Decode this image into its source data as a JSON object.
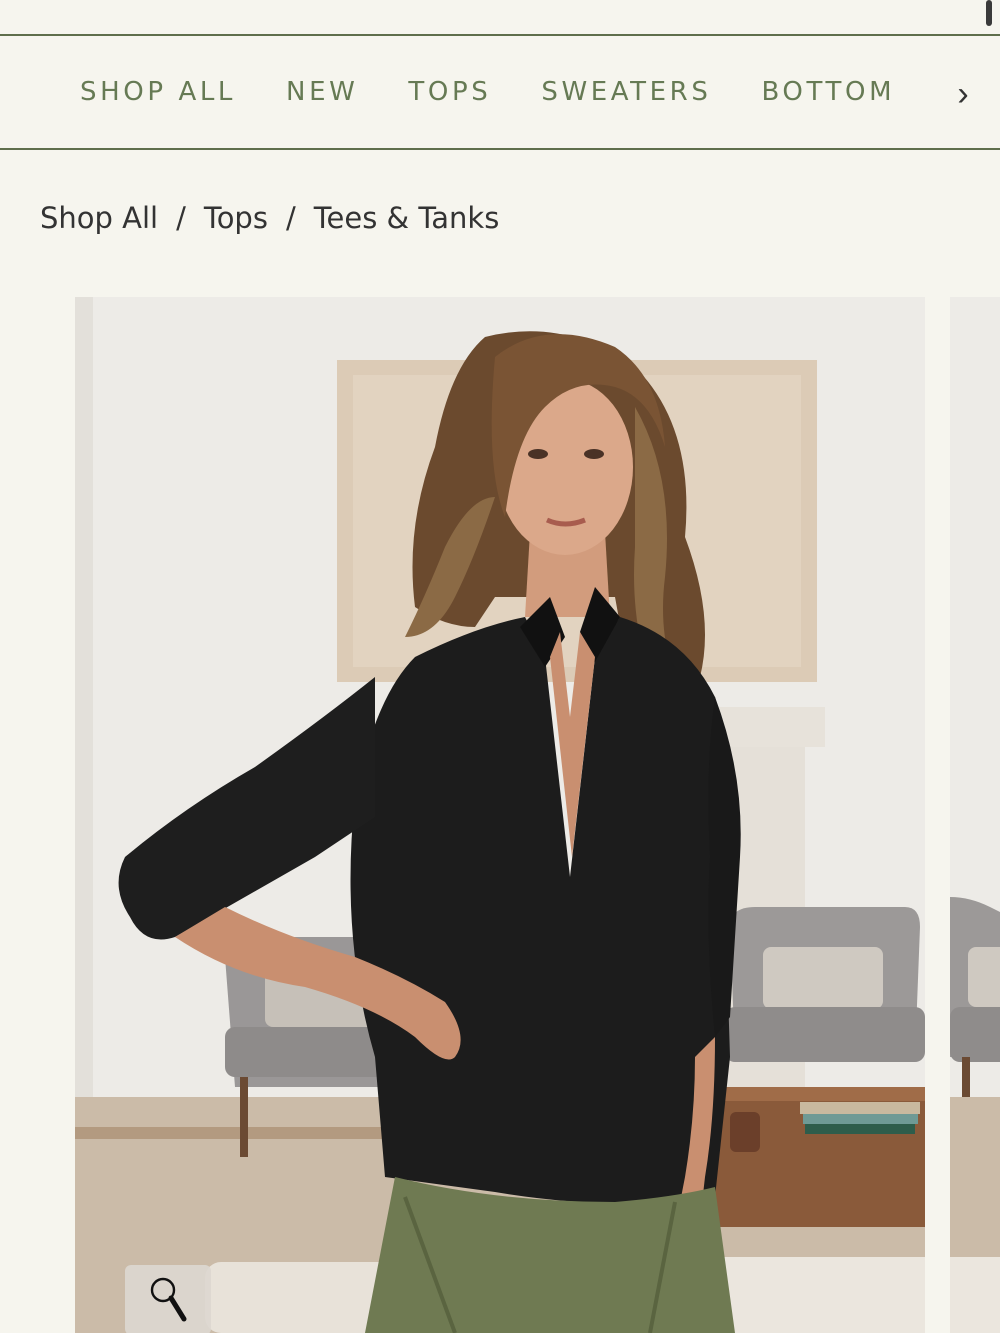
{
  "nav": {
    "items": [
      {
        "label": "SHOP ALL"
      },
      {
        "label": "NEW"
      },
      {
        "label": "TOPS"
      },
      {
        "label": "SWEATERS"
      },
      {
        "label": "BOTTOM"
      }
    ],
    "next_icon": "chevron-right-icon"
  },
  "breadcrumb": {
    "items": [
      "Shop All",
      "Tops",
      "Tees & Tanks"
    ],
    "separator": "/"
  },
  "gallery": {
    "zoom_icon": "magnifier-icon"
  },
  "colors": {
    "background": "#f6f5ee",
    "nav_text": "#667a54",
    "nav_border": "#5f6e4c",
    "text": "#333333"
  }
}
